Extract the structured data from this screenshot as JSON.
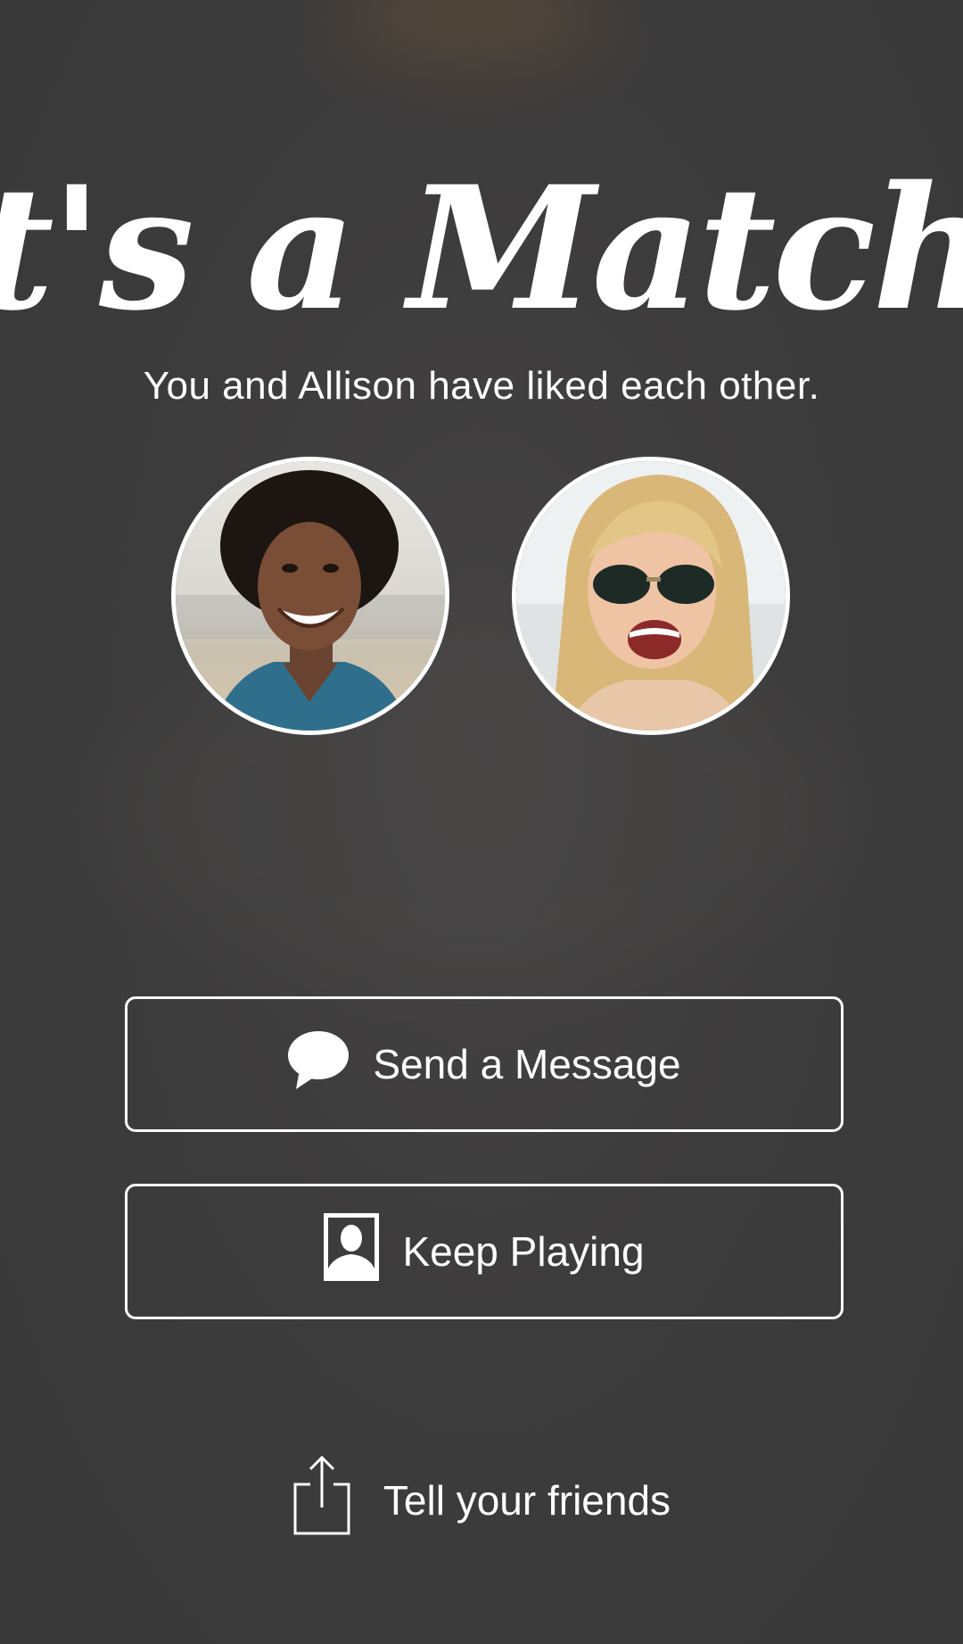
{
  "header": {
    "title": "It's a Match!",
    "subtitle": "You and Allison have liked each other."
  },
  "profiles": [
    {
      "role": "you",
      "icon": "profile-photo-man"
    },
    {
      "role": "match",
      "name": "Allison",
      "icon": "profile-photo-woman"
    }
  ],
  "actions": {
    "send_message": {
      "label": "Send a Message",
      "icon": "speech-bubble-icon"
    },
    "keep_playing": {
      "label": "Keep Playing",
      "icon": "person-silhouette-icon"
    },
    "tell_friends": {
      "label": "Tell your friends",
      "icon": "share-icon"
    }
  },
  "colors": {
    "background": "#3b3b3b",
    "foreground": "#ffffff"
  }
}
